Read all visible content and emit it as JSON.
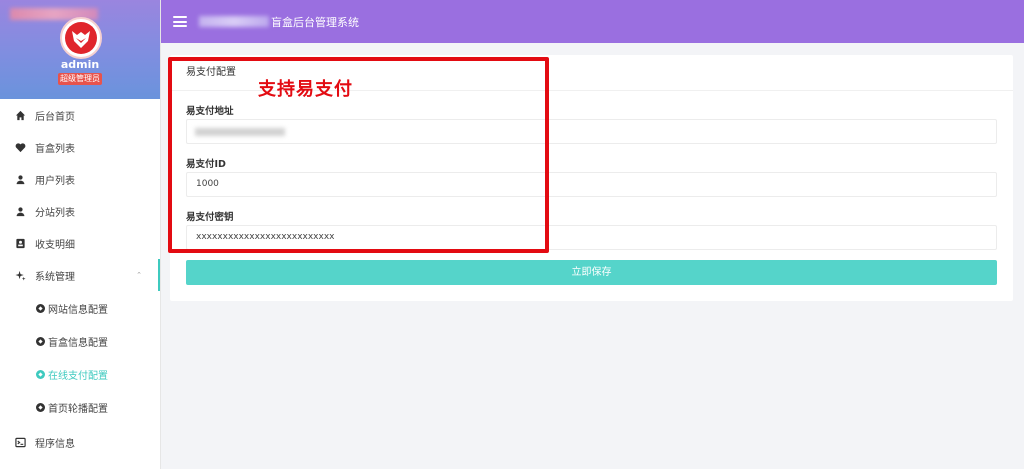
{
  "sidebar": {
    "username": "admin",
    "role": "超级管理员",
    "items": [
      {
        "label": "后台首页",
        "icon": "home-icon"
      },
      {
        "label": "盲盒列表",
        "icon": "heart-icon"
      },
      {
        "label": "用户列表",
        "icon": "user-icon"
      },
      {
        "label": "分站列表",
        "icon": "user-icon"
      },
      {
        "label": "收支明细",
        "icon": "contact-card-icon"
      },
      {
        "label": "系统管理",
        "icon": "sparkle-icon"
      }
    ],
    "sub_items": [
      {
        "label": "网站信息配置"
      },
      {
        "label": "盲盒信息配置"
      },
      {
        "label": "在线支付配置"
      },
      {
        "label": "首页轮播配置"
      }
    ],
    "bottom_item": {
      "label": "程序信息",
      "icon": "terminal-icon"
    }
  },
  "topbar": {
    "title": "盲盒后台管理系统"
  },
  "card": {
    "header": "易支付配置",
    "fields": [
      {
        "label": "易支付地址",
        "value": ""
      },
      {
        "label": "易支付ID",
        "value": "1000"
      },
      {
        "label": "易支付密钥",
        "value": "xxxxxxxxxxxxxxxxxxxxxxxxxx"
      }
    ],
    "save_label": "立即保存"
  },
  "annotation": {
    "text": "支持易支付",
    "color": "#e30b12"
  },
  "colors": {
    "accent": "#3ecabf",
    "topbar": "#9a6fe0",
    "button": "#55d4ca"
  }
}
